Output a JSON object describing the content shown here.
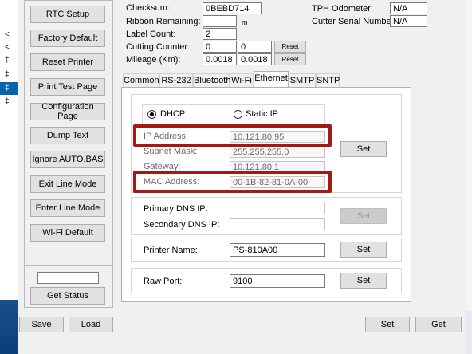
{
  "background_rows": [
    "<",
    "<",
    "‡",
    "‡",
    "‡",
    "‡"
  ],
  "left_buttons": [
    "RTC Setup",
    "Factory Default",
    "Reset Printer",
    "Print Test Page",
    "Configuration Page",
    "Dump Text",
    "Ignore AUTO.BAS",
    "Exit Line Mode",
    "Enter Line Mode",
    "Wi-Fi Default"
  ],
  "status": {
    "field_value": "",
    "button": "Get Status"
  },
  "info": {
    "checksum_label": "Checksum:",
    "checksum_value": "0BEBD714",
    "ribbon_label": "Ribbon Remaining:",
    "ribbon_value": "",
    "ribbon_unit": "m",
    "label_count_label": "Label Count:",
    "label_count_value": "2",
    "cutting_label": "Cutting Counter:",
    "cutting_value1": "0",
    "cutting_value2": "0",
    "cutting_reset": "Reset",
    "mileage_label": "Mileage (Km):",
    "mileage_value1": "0.0018",
    "mileage_value2": "0.0018",
    "mileage_reset": "Reset",
    "tph_label": "TPH Odometer:",
    "tph_value": "N/A",
    "cutter_serial_label": "Cutter Serial Number:",
    "cutter_serial_value": "N/A"
  },
  "tabs": [
    "Common",
    "RS-232",
    "Bluetooth",
    "Wi-Fi",
    "Ethernet",
    "SMTP",
    "SNTP"
  ],
  "active_tab": "Ethernet",
  "ethernet": {
    "dhcp_label": "DHCP",
    "static_label": "Static IP",
    "mode": "DHCP",
    "ip_label": "IP Address:",
    "ip_value": "10.121.80.95",
    "subnet_label": "Subnet Mask:",
    "subnet_value": "255.255.255.0",
    "gateway_label": "Gateway:",
    "gateway_value": "10.121.80.1",
    "mac_label": "MAC Address:",
    "mac_value": "00-1B-82-81-0A-00",
    "set1": "Set",
    "primary_dns_label": "Primary DNS IP:",
    "primary_dns_value": "",
    "secondary_dns_label": "Secondary DNS IP:",
    "secondary_dns_value": "",
    "set2": "Set",
    "printer_name_label": "Printer Name:",
    "printer_name_value": "PS-810A00",
    "set3": "Set",
    "raw_port_label": "Raw Port:",
    "raw_port_value": "9100",
    "set4": "Set"
  },
  "bottom": {
    "save": "Save",
    "load": "Load",
    "set": "Set",
    "get": "Get"
  },
  "colors": {
    "highlight": "#a31a14",
    "selection": "#0a64ad"
  }
}
